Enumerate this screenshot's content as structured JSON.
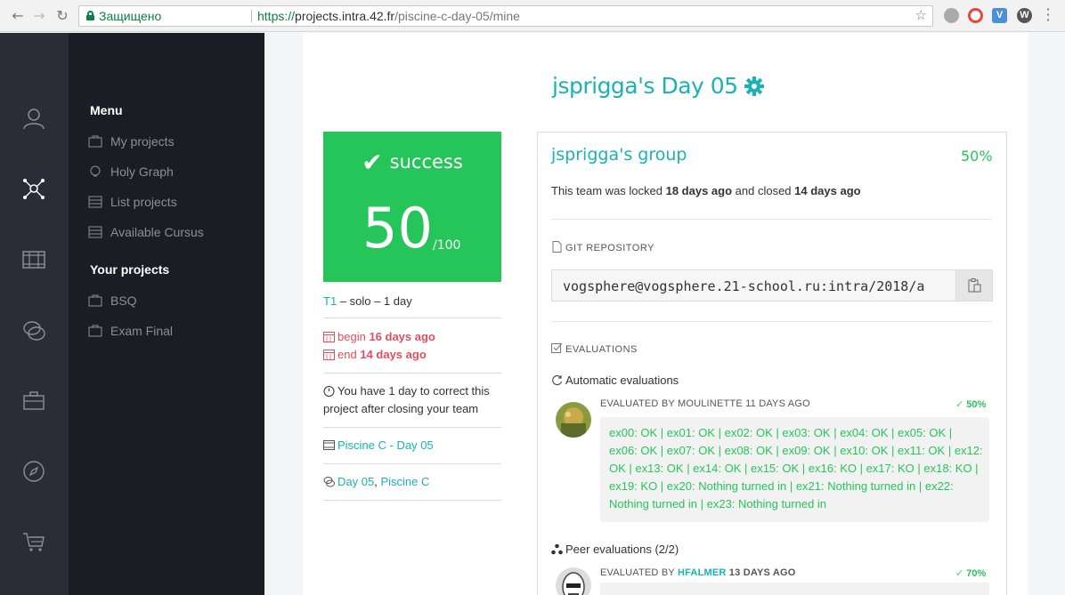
{
  "browser": {
    "secure_label": "Защищено",
    "url_scheme": "https://",
    "url_host": "projects.intra.42.fr",
    "url_path": "/piscine-c-day-05/mine"
  },
  "sidebar": {
    "menu_heading": "Menu",
    "menu_items": [
      "My projects",
      "Holy Graph",
      "List projects",
      "Available Cursus"
    ],
    "projects_heading": "Your projects",
    "project_items": [
      "BSQ",
      "Exam Final"
    ]
  },
  "page": {
    "title": "jsprigga's Day 05"
  },
  "score_card": {
    "status": "success",
    "score": "50",
    "score_max": "/100"
  },
  "info": {
    "tier": "T1",
    "meta": " – solo – 1 day",
    "begin_label": "begin",
    "begin_value": "16 days ago",
    "end_label": "end",
    "end_value": "14 days ago",
    "correction_note": "You have 1 day to correct this project after closing your team",
    "project_link": "Piscine C - Day 05",
    "forum_link_1": "Day 05",
    "forum_sep": ", ",
    "forum_link_2": "Piscine C"
  },
  "group": {
    "title": "jsprigga's group",
    "percent": "50%",
    "locked_prefix": "This team was locked ",
    "locked_value": "18 days ago",
    "closed_prefix": " and closed ",
    "closed_value": "14 days ago",
    "git_label": "GIT REPOSITORY",
    "repo_url": "vogsphere@vogsphere.21-school.ru:intra/2018/a",
    "evaluations_label": "EVALUATIONS",
    "automatic_label": "Automatic evaluations",
    "auto_eval": {
      "head": "EVALUATED BY MOULINETTE 11 DAYS AGO",
      "percent": "50%",
      "result": "ex00: OK | ex01: OK | ex02: OK | ex03: OK | ex04: OK | ex05: OK | ex06: OK | ex07: OK | ex08: OK | ex09: OK | ex10: OK | ex11: OK | ex12: OK | ex13: OK | ex14: OK | ex15: OK | ex16: KO | ex17: KO | ex18: KO | ex19: KO | ex20: Nothing turned in | ex21: Nothing turned in | ex22: Nothing turned in | ex23: Nothing turned in"
    },
    "peer_label": "Peer evaluations (2/2)",
    "peer_eval": {
      "head_prefix": "EVALUATED BY ",
      "evaluator": "HFALMER",
      "head_suffix": " 13 DAYS AGO",
      "percent": "70%"
    }
  },
  "colors": {
    "teal": "#1bb1b5",
    "success_green": "#26c55a",
    "danger_red": "#e04e5e",
    "sidebar_dark": "#1b1d24",
    "rail": "#2a2d38"
  }
}
